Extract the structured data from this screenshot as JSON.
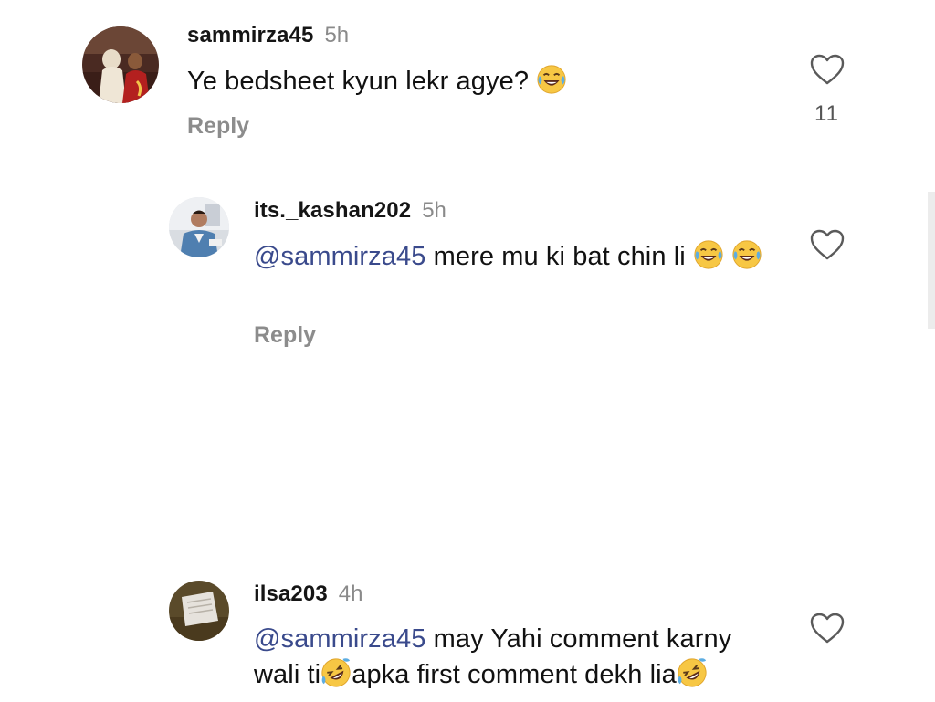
{
  "comments": [
    {
      "username": "sammirza45",
      "time": "5h",
      "text": "Ye bedsheet kyun lekr agye?",
      "text_emoji": "face-with-tears-of-joy",
      "reply_label": "Reply",
      "like_count": "11"
    },
    {
      "username": "its._kashan202",
      "time": "5h",
      "mention": "@sammirza45",
      "text": "mere mu ki bat chin li",
      "text_emoji": "face-with-tears-of-joy",
      "reply_label": "Reply"
    },
    {
      "username": "ilsa203",
      "time": "4h",
      "mention": "@sammirza45",
      "text_line1": "may Yahi comment karny",
      "text_line2a": "wali ti",
      "text_line2b": "apka first comment dekh lia",
      "text_emoji": "rolling-on-the-floor-laughing"
    }
  ],
  "colors": {
    "mention": "#3a4a8c",
    "muted": "#8c8c8c",
    "text": "#111111",
    "background": "#ffffff"
  },
  "icons": {
    "like": "heart-outline-icon",
    "emoji_joy": "face-with-tears-of-joy",
    "emoji_rofl": "rolling-on-the-floor-laughing"
  }
}
